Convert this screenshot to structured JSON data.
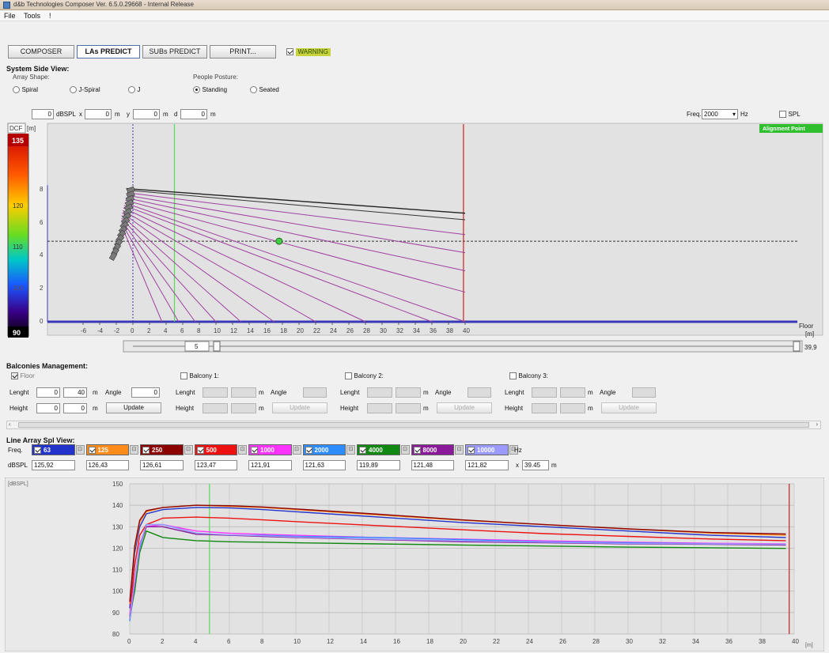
{
  "window": {
    "title": "d&b Technologies Composer Ver. 6.5.0.29668 - Internal Release"
  },
  "menu": {
    "items": [
      "File",
      "Tools",
      "!"
    ]
  },
  "tabs": {
    "items": [
      {
        "label": "COMPOSER"
      },
      {
        "label": "LAs PREDICT"
      },
      {
        "label": "SUBs PREDICT"
      },
      {
        "label": "PRINT..."
      }
    ],
    "warning_label": "WARNING"
  },
  "system_side": {
    "title": "System Side View:",
    "array_shape": {
      "label": "Array Shape:",
      "options": [
        "Spiral",
        "J-Spiral",
        "J"
      ]
    },
    "people_posture": {
      "label": "People Posture:",
      "options": [
        "Standing",
        "Seated"
      ]
    },
    "coords": {
      "dbspl": "0",
      "dbspl_label": "dBSPL",
      "x_label": "x",
      "x": "0",
      "y_label": "y",
      "y": "0",
      "d_label": "d",
      "d": "0",
      "unit": "m"
    },
    "freq": {
      "label": "Freq.",
      "value": "2000",
      "unit": "Hz"
    },
    "spl_label": "SPL",
    "alignment_label": "Alignment Point",
    "floor_label": "Floor",
    "m_label": "[m]",
    "dcf_label": "DCF",
    "colorscale": {
      "max": "135",
      "min": "90",
      "ticks": [
        "120",
        "110",
        "100"
      ]
    },
    "y_ticks": [
      "8",
      "6",
      "4",
      "2",
      "0"
    ],
    "x_ticks": [
      "-6",
      "-4",
      "-2",
      "0",
      "2",
      "4",
      "6",
      "8",
      "10",
      "12",
      "14",
      "16",
      "18",
      "20",
      "22",
      "24",
      "26",
      "28",
      "30",
      "32",
      "34",
      "36",
      "38",
      "40"
    ],
    "slider": {
      "value": "5",
      "max": "39,9"
    }
  },
  "balconies": {
    "title": "Balconies Management:",
    "floor": {
      "label": "Floor",
      "length_label": "Lenght",
      "length_a": "0",
      "length_b": "40",
      "unit": "m",
      "angle_label": "Angle",
      "angle": "0",
      "height_label": "Height",
      "height_a": "0",
      "height_b": "0",
      "update_label": "Update"
    },
    "balcony_labels": [
      "Balcony 1:",
      "Balcony 2:",
      "Balcony 3:"
    ],
    "length_label": "Lenght",
    "height_label": "Height",
    "angle_label": "Angle",
    "unit": "m",
    "update_label": "Update"
  },
  "line_array": {
    "title": "Line Array Spl View:",
    "freq_label": "Freq.",
    "dbspl_label": "dBSPL",
    "hz_label": "Hz",
    "x_label": "x",
    "x_value": "39.45",
    "x_unit": "m",
    "bands": [
      {
        "freq": "63",
        "spl": "125,92",
        "color": "#2233cc"
      },
      {
        "freq": "125",
        "spl": "126,43",
        "color": "#ff8c1a"
      },
      {
        "freq": "250",
        "spl": "126,61",
        "color": "#8b0000"
      },
      {
        "freq": "500",
        "spl": "123,47",
        "color": "#ee1111"
      },
      {
        "freq": "1000",
        "spl": "121,91",
        "color": "#ff33ff"
      },
      {
        "freq": "2000",
        "spl": "121,63",
        "color": "#2f8cff"
      },
      {
        "freq": "4000",
        "spl": "119,89",
        "color": "#118811"
      },
      {
        "freq": "8000",
        "spl": "121,48",
        "color": "#8a1a9a"
      },
      {
        "freq": "10000",
        "spl": "121,82",
        "color": "#9a9aff"
      }
    ]
  },
  "chart_data": {
    "type": "line",
    "xlabel": "[m]",
    "ylabel": "[dBSPL]",
    "xlim": [
      0,
      40
    ],
    "ylim": [
      80,
      150
    ],
    "xticks": [
      0,
      2,
      4,
      6,
      8,
      10,
      12,
      14,
      16,
      18,
      20,
      22,
      24,
      26,
      28,
      30,
      32,
      34,
      36,
      38,
      40
    ],
    "yticks": [
      80,
      90,
      100,
      110,
      120,
      130,
      140,
      150
    ],
    "x": [
      0,
      0.3,
      0.6,
      1,
      2,
      4,
      6,
      8,
      10,
      15,
      20,
      25,
      30,
      35,
      39.5
    ],
    "series": [
      {
        "name": "63",
        "color": "#2233cc",
        "values": [
          92,
          118,
          130,
          136,
          138,
          139,
          138.8,
          138,
          137,
          134.5,
          132,
          130,
          128,
          126,
          125
        ]
      },
      {
        "name": "125",
        "color": "#ff8c1a",
        "values": [
          94,
          120,
          132,
          137,
          139,
          140,
          139.5,
          139,
          138,
          135.5,
          133,
          131,
          129,
          127,
          126
        ]
      },
      {
        "name": "250",
        "color": "#8b0000",
        "values": [
          95,
          121,
          133,
          137.5,
          139,
          140,
          139.8,
          139.2,
          138.3,
          135.8,
          133.2,
          131,
          129,
          127.3,
          126.6
        ]
      },
      {
        "name": "500",
        "color": "#ee1111",
        "values": [
          88,
          112,
          126,
          131,
          134,
          134.5,
          134,
          133.2,
          132.4,
          130.5,
          128.6,
          126.8,
          125.5,
          124.3,
          123.5
        ]
      },
      {
        "name": "1000",
        "color": "#ff33ff",
        "values": [
          89,
          105,
          122,
          130,
          131,
          128,
          127,
          126.5,
          126,
          125,
          124.2,
          123.4,
          122.8,
          122.3,
          122
        ]
      },
      {
        "name": "2000",
        "color": "#2f8cff",
        "values": [
          86,
          102,
          120,
          131,
          131,
          127,
          126,
          126,
          125.5,
          125,
          124,
          123,
          122.5,
          122,
          121.6
        ]
      },
      {
        "name": "4000",
        "color": "#118811",
        "values": [
          88,
          100,
          118,
          128,
          125,
          123.5,
          123,
          122.8,
          122.5,
          122,
          121.5,
          121,
          120.5,
          120.2,
          119.9
        ]
      },
      {
        "name": "8000",
        "color": "#8a1a9a",
        "values": [
          87,
          103,
          121,
          130,
          130,
          126.5,
          126,
          125.5,
          125,
          124,
          123,
          122.5,
          122,
          121.8,
          121.5
        ]
      },
      {
        "name": "10000",
        "color": "#9a9aff",
        "values": [
          87,
          104,
          121,
          131,
          131,
          127,
          126.2,
          125.8,
          125.2,
          124.2,
          123.4,
          122.8,
          122.2,
          122,
          121.8
        ]
      }
    ],
    "markers": [
      {
        "x": 4.8,
        "color": "#55dd55"
      },
      {
        "x": 39.7,
        "color": "#cc2222"
      }
    ]
  }
}
